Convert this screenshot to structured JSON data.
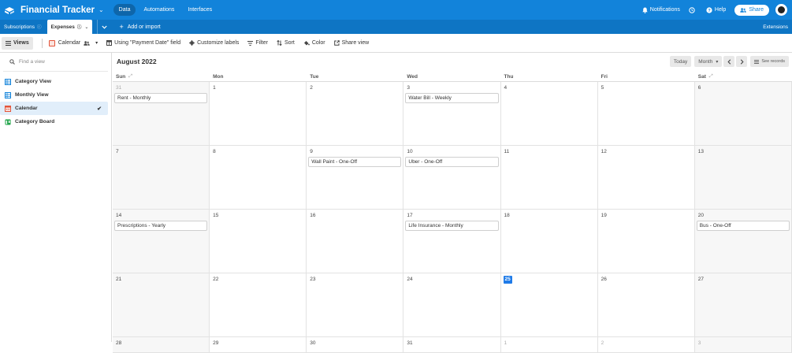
{
  "app": {
    "title": "Financial Tracker",
    "nav": [
      "Data",
      "Automations",
      "Interfaces"
    ],
    "active_nav": "Data",
    "notifications_label": "Notifications",
    "help_label": "Help",
    "share_label": "Share",
    "brand_color": "#1283da"
  },
  "tables": {
    "items": [
      "Subscriptions",
      "Expenses"
    ],
    "active": "Expenses",
    "add_import_label": "Add or import",
    "extensions_label": "Extensions"
  },
  "toolbar": {
    "views_label": "Views",
    "view_name": "Calendar",
    "using_field_label": "Using \"Payment Date\" field",
    "customize_labels": "Customize labels",
    "filter_label": "Filter",
    "sort_label": "Sort",
    "color_label": "Color",
    "share_view_label": "Share view"
  },
  "sidebar": {
    "find_placeholder": "Find a view",
    "views": [
      {
        "label": "Category View",
        "icon": "grid-icon",
        "color": "#1283da"
      },
      {
        "label": "Monthly View",
        "icon": "grid-icon",
        "color": "#1283da"
      },
      {
        "label": "Calendar",
        "icon": "calendar-icon",
        "color": "#e3543a",
        "selected": true
      },
      {
        "label": "Category Board",
        "icon": "kanban-icon",
        "color": "#20a44a"
      }
    ]
  },
  "calendar": {
    "month_title": "August 2022",
    "today_label": "Today",
    "range_label": "Month",
    "see_records_label": "See records",
    "weekdays": [
      "Sun",
      "Mon",
      "Tue",
      "Wed",
      "Thu",
      "Fri",
      "Sat"
    ],
    "weeks": [
      [
        "31",
        "1",
        "2",
        "3",
        "4",
        "5",
        "6"
      ],
      [
        "7",
        "8",
        "9",
        "10",
        "11",
        "12",
        "13"
      ],
      [
        "14",
        "15",
        "16",
        "17",
        "18",
        "19",
        "20"
      ],
      [
        "21",
        "22",
        "23",
        "24",
        "25",
        "26",
        "27"
      ],
      [
        "28",
        "29",
        "30",
        "31",
        "1",
        "2",
        "3"
      ]
    ],
    "today": "25",
    "events": {
      "0-0": "Rent - Monthly",
      "0-3": "Water Bill - Weekly",
      "1-2": "Wall Paint - One-Off",
      "1-3": "Uber - One-Off",
      "2-0": "Prescriptions - Yearly",
      "2-3": "Life Insurance - Monthly",
      "2-6": "Bus - One-Off"
    }
  }
}
